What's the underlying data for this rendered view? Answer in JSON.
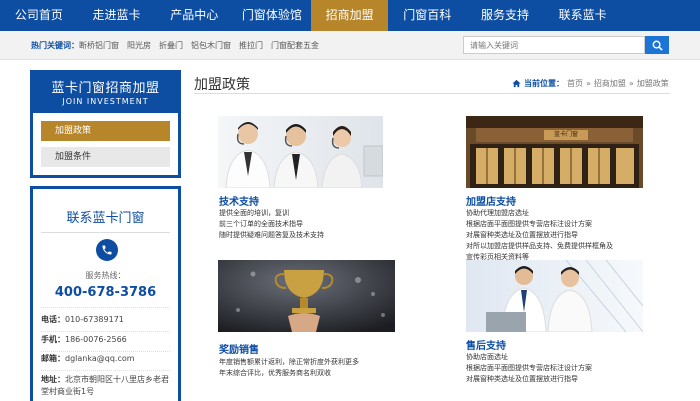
{
  "nav": {
    "items": [
      "公司首页",
      "走进蓝卡",
      "产品中心",
      "门窗体验馆",
      "招商加盟",
      "门窗百科",
      "服务支持",
      "联系蓝卡"
    ],
    "active_index": 4
  },
  "hotbar": {
    "label": "热门关键词：",
    "links": [
      "断桥铝门窗",
      "阳光房",
      "折叠门",
      "铝包木门窗",
      "推拉门",
      "门窗配套五金"
    ],
    "search_placeholder": "请输入关键词"
  },
  "sidebar": {
    "title": "蓝卡门窗招商加盟",
    "subtitle": "JOIN INVESTMENT",
    "menu": [
      "加盟政策",
      "加盟条件"
    ]
  },
  "contact": {
    "title": "联系蓝卡门窗",
    "hotline_label": "服务热线：",
    "hotline": "400-678-3786",
    "tel_label": "电话：",
    "tel": "010-67389171",
    "mobile_label": "手机：",
    "mobile": "186-0076-2566",
    "email_label": "邮箱：",
    "email": "dglanka@qq.com",
    "address_label": "地址：",
    "address": "北京市朝阳区十八里店乡老君堂村商业街1号"
  },
  "main": {
    "title": "加盟政策",
    "breadcrumb": {
      "label": "当前位置：",
      "items": [
        "首页",
        "招商加盟",
        "加盟政策"
      ],
      "separator": "»"
    },
    "cards": [
      {
        "title": "技术支持",
        "lines": [
          "提供全面的培训，复训",
          "前三个订单的全面技术指导",
          "随时提供疑难问题答复及技术支持"
        ]
      },
      {
        "title": "加盟店支持",
        "lines": [
          "协助代理加盟店选址",
          "根据店面平面图提供专营店标注设计方案",
          "对展窗种类选址及位置摆放进行指导",
          "对所以加盟店提供样品支持、免费提供样框角及",
          "宣传彩页相关资料等"
        ]
      },
      {
        "title": "奖励销售",
        "lines": [
          "年度销售额累计返利，除正常折度外获利更多",
          "年末综合评比，优秀服务商名利双收"
        ]
      },
      {
        "title": "售后支持",
        "lines": [
          "协助店面选址",
          "根据店面平面图提供专营店标注设计方案",
          "对展窗种类选址及位置摆放进行指导"
        ]
      }
    ],
    "store_sign": "蓝卡门窗"
  },
  "colors": {
    "primary": "#0d4ea3",
    "accent": "#b7862a"
  }
}
